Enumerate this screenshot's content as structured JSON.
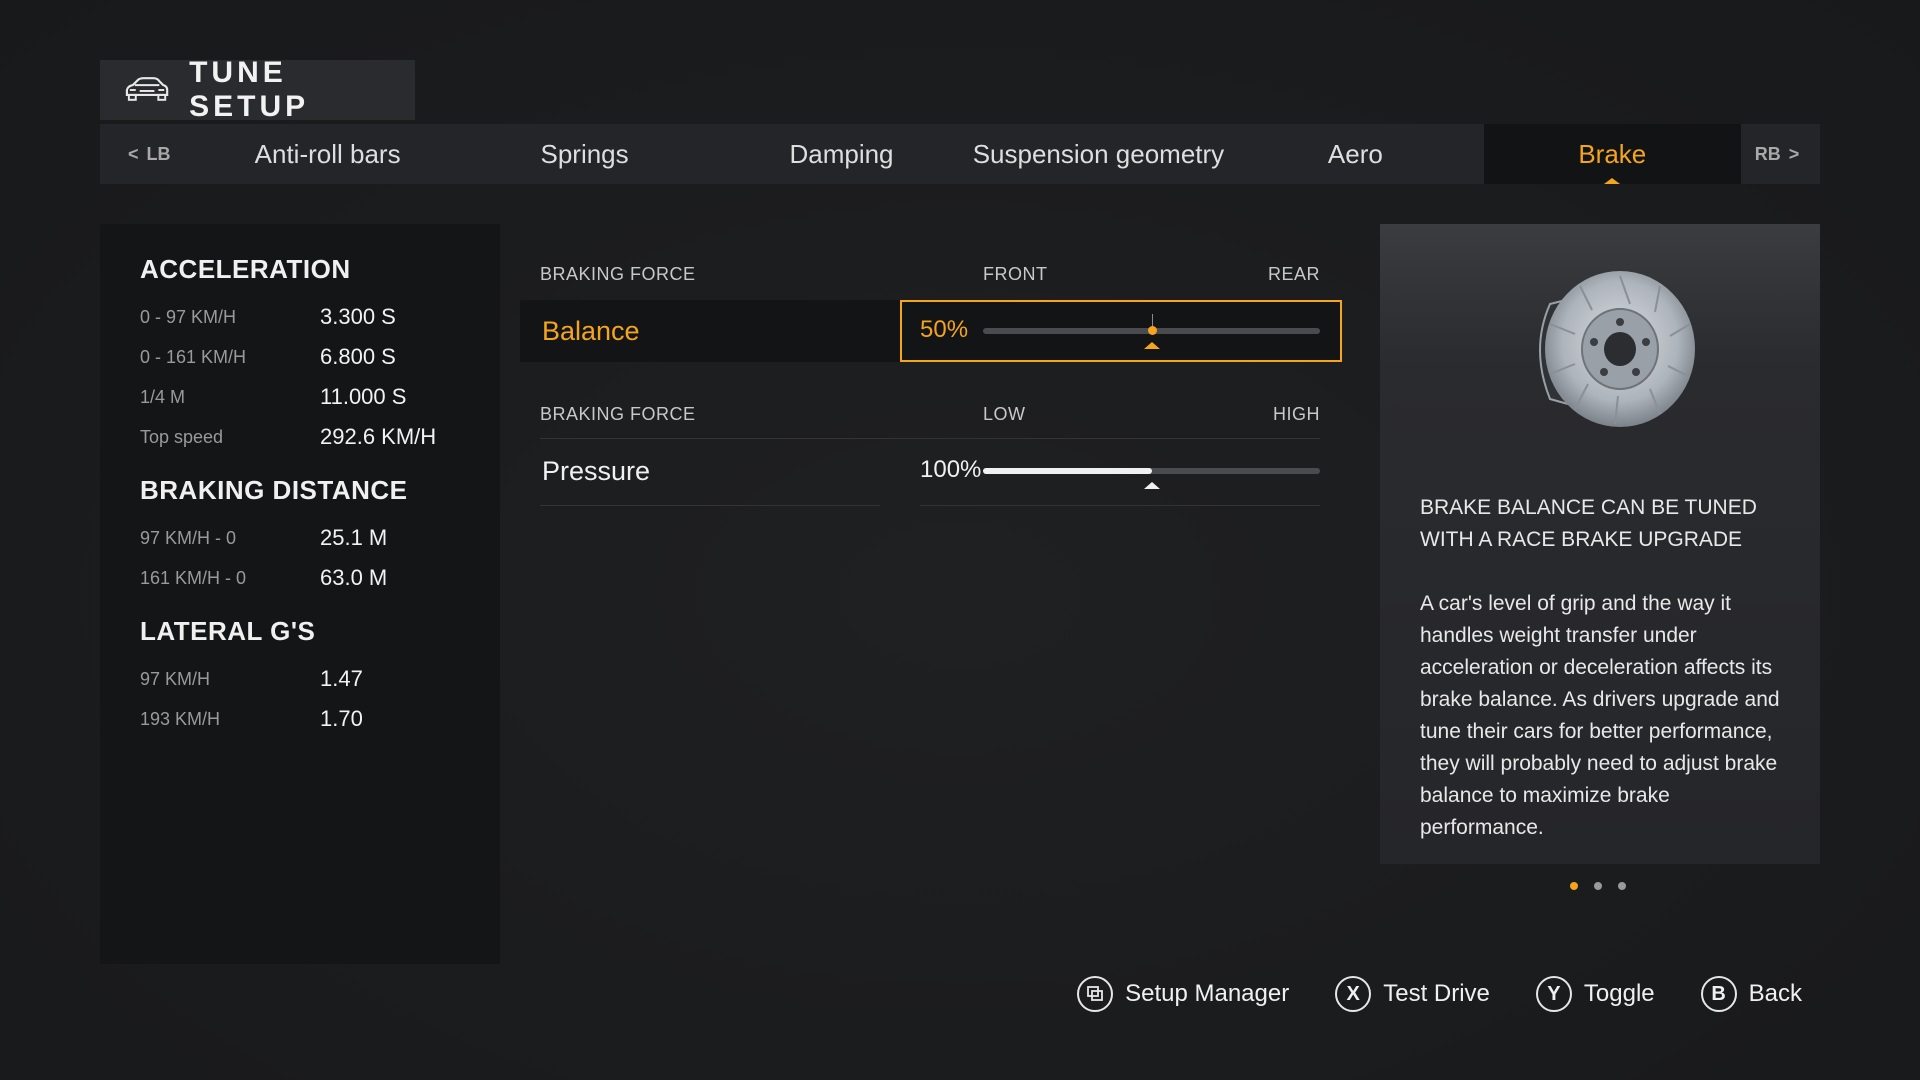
{
  "header": {
    "title": "TUNE SETUP",
    "icon": "car-icon"
  },
  "tabs": {
    "left_bumper": "LB",
    "right_bumper": "RB",
    "items": [
      {
        "label": "Anti-roll bars",
        "active": false
      },
      {
        "label": "Springs",
        "active": false
      },
      {
        "label": "Damping",
        "active": false
      },
      {
        "label": "Suspension geometry",
        "active": false
      },
      {
        "label": "Aero",
        "active": false
      },
      {
        "label": "Brake",
        "active": true
      }
    ]
  },
  "stats": {
    "acceleration": {
      "heading": "ACCELERATION",
      "rows": [
        {
          "label": "0 - 97 KM/H",
          "value": "3.300 S"
        },
        {
          "label": "0 - 161 KM/H",
          "value": "6.800 S"
        },
        {
          "label": "1/4 M",
          "value": "11.000 S"
        },
        {
          "label": "Top speed",
          "value": "292.6 KM/H"
        }
      ]
    },
    "braking": {
      "heading": "BRAKING DISTANCE",
      "rows": [
        {
          "label": "97 KM/H - 0",
          "value": "25.1 M"
        },
        {
          "label": "161 KM/H - 0",
          "value": "63.0 M"
        }
      ]
    },
    "lateral": {
      "heading": "LATERAL G'S",
      "rows": [
        {
          "label": "97 KM/H",
          "value": "1.47"
        },
        {
          "label": "193 KM/H",
          "value": "1.70"
        }
      ]
    }
  },
  "settings": {
    "balance": {
      "group_label": "BRAKING FORCE",
      "low_label": "FRONT",
      "high_label": "REAR",
      "name": "Balance",
      "value_text": "50%",
      "level": 0.5,
      "default_level": 0.5
    },
    "pressure": {
      "group_label": "BRAKING FORCE",
      "low_label": "LOW",
      "high_label": "HIGH",
      "name": "Pressure",
      "value_text": "100%",
      "level": 0.5,
      "default_level": 0.5
    }
  },
  "info": {
    "image": "brake-disc-image",
    "heading": "BRAKE BALANCE CAN BE TUNED WITH A RACE BRAKE UPGRADE",
    "body": "A car's level of grip and the way it handles weight transfer under acceleration or deceleration affects its brake balance. As drivers upgrade and tune their cars for better performance, they will probably need to adjust brake balance to maximize brake performance.",
    "pages": 3,
    "current_page": 1
  },
  "footer": {
    "setup_manager": "Setup Manager",
    "test_drive_key": "X",
    "test_drive": "Test Drive",
    "toggle_key": "Y",
    "toggle": "Toggle",
    "back_key": "B",
    "back": "Back"
  },
  "colors": {
    "accent": "#f4a51c",
    "panel": "#141517",
    "background": "#1c1d1f"
  }
}
